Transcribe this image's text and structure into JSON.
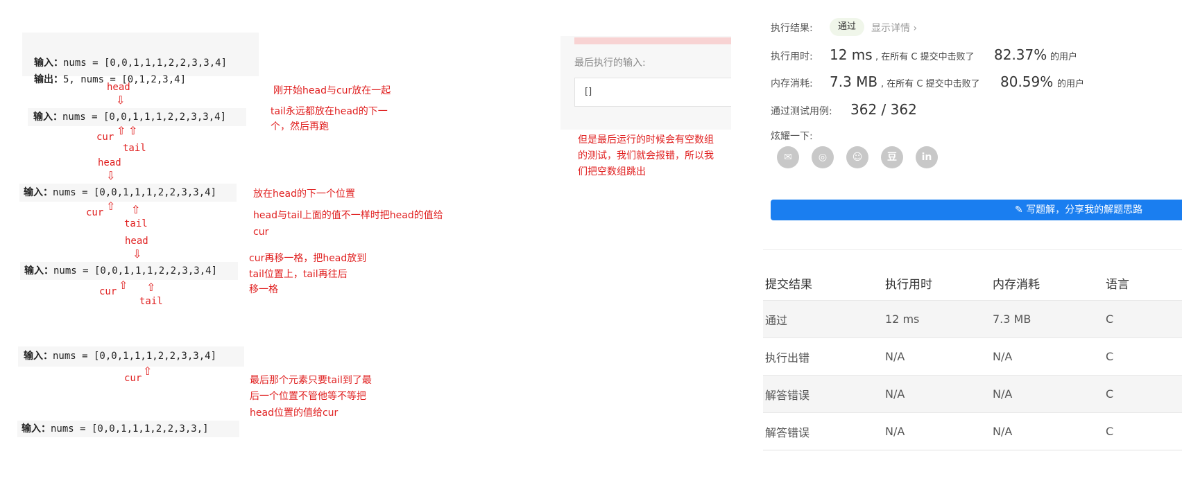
{
  "example": {
    "input_label": "输入：",
    "input_value": "nums = [0,0,1,1,1,2,2,3,3,4]",
    "output_label": "输出：",
    "output_value": "5, nums = [0,1,2,3,4]"
  },
  "diagram": {
    "step1": {
      "head": "head",
      "cur": "cur",
      "tail": "tail",
      "note": "刚开始head与cur放在一起",
      "note2_line1": "tail永远都放在head的下一",
      "note2_line2": "个，然后再跑"
    },
    "step2": {
      "head": "head",
      "cur": "cur",
      "tail": "tail",
      "note": "放在head的下一个位置",
      "note2_line1": "head与tail上面的值不一样时把head的值给",
      "note2_line2": "cur"
    },
    "step3": {
      "head": "head",
      "cur": "cur",
      "tail": "tail",
      "note_line1": "cur再移一格，把head放到",
      "note_line2": "tail位置上，tail再往后",
      "note_line3": "移一格"
    },
    "step4": {
      "cur": "cur",
      "note_line1": "最后那个元素只要tail到了最",
      "note_line2": "后一个位置不管他等不等把",
      "note_line3": "head位置的值给cur"
    },
    "last_input_value": "nums = [0,0,1,1,1,2,2,3,3,]"
  },
  "middle": {
    "last_input_label": "最后执行的输入:",
    "last_input_value": "[]",
    "note_line1": "但是最后运行的时候会有空数组",
    "note_line2": "的测试，我们就会报错，所以我",
    "note_line3": "们把空数组跳出"
  },
  "result": {
    "exec_result_label": "执行结果:",
    "status_badge": "通过",
    "details_link": "显示详情 ›",
    "time_label": "执行用时:",
    "time_value": "12 ms",
    "time_desc": ", 在所有 C 提交中击败了",
    "time_percent": "82.37%",
    "time_suffix": "的用户",
    "mem_label": "内存消耗:",
    "mem_value": "7.3 MB",
    "mem_desc": ", 在所有 C 提交中击败了",
    "mem_percent": "80.59%",
    "mem_suffix": "的用户",
    "tests_label": "通过测试用例:",
    "tests_value": "362 / 362",
    "share_label": "炫耀一下:",
    "share_icons": [
      "wechat-icon",
      "weibo-icon",
      "qq-icon",
      "douban-icon",
      "linkedin-icon"
    ],
    "write_solution_button": "写题解，分享我的解题思路"
  },
  "submissions": {
    "headers": [
      "提交结果",
      "执行用时",
      "内存消耗",
      "语言"
    ],
    "rows": [
      {
        "status": "通过",
        "time": "12 ms",
        "memory": "7.3 MB",
        "lang": "C"
      },
      {
        "status": "执行出错",
        "time": "N/A",
        "memory": "N/A",
        "lang": "C"
      },
      {
        "status": "解答错误",
        "time": "N/A",
        "memory": "N/A",
        "lang": "C"
      },
      {
        "status": "解答错误",
        "time": "N/A",
        "memory": "N/A",
        "lang": "C"
      }
    ]
  },
  "colors": {
    "annotation": "#e02020",
    "accent": "#1a7ef0",
    "pass": "#5cb85c",
    "error": "#e64545"
  }
}
